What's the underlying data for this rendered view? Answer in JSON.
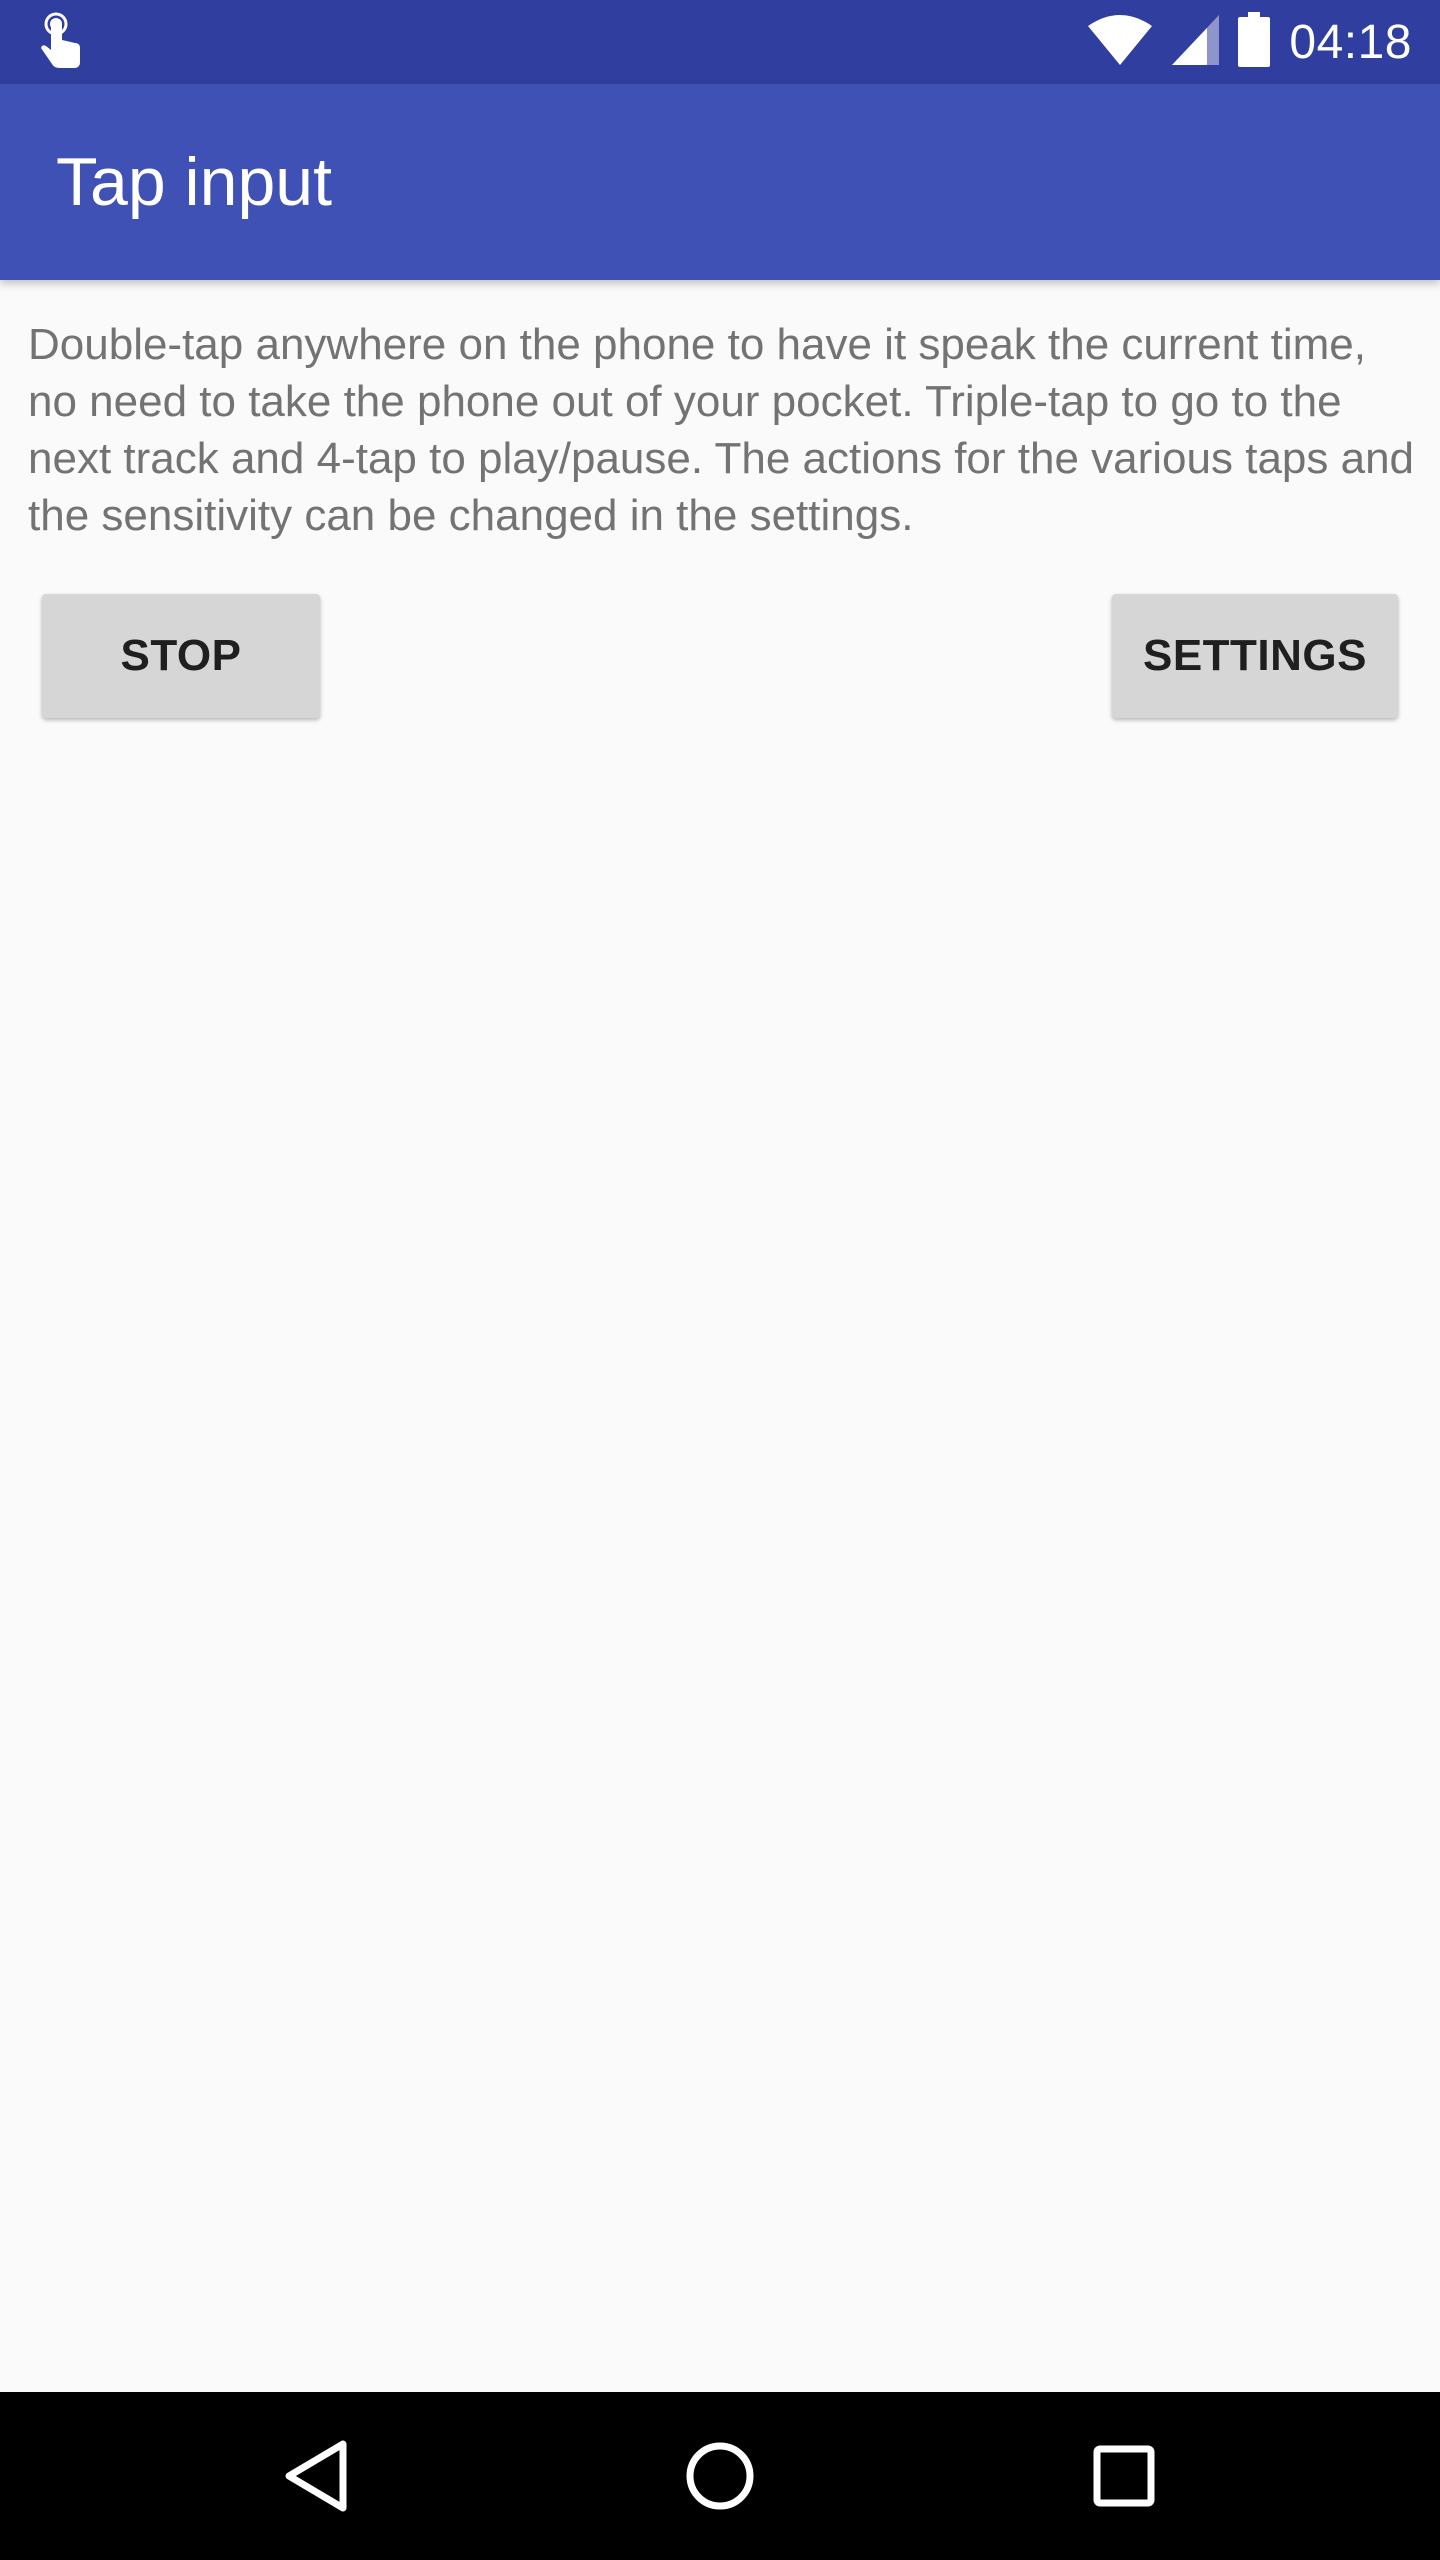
{
  "status_bar": {
    "time": "04:18",
    "notification_icon": "touch-app-icon",
    "wifi_icon": "wifi-icon",
    "signal_icon": "cell-signal-icon",
    "battery_icon": "battery-icon"
  },
  "app_bar": {
    "title": "Tap input"
  },
  "main": {
    "description": "Double-tap anywhere on the phone to have it speak the current time, no need to take the phone out of your pocket. Triple-tap to go to the next track and 4-tap to play/pause. The actions for the various taps and the sensitivity can be changed in the settings.",
    "stop_label": "STOP",
    "settings_label": "SETTINGS"
  },
  "nav_bar": {
    "back_icon": "back-triangle-icon",
    "home_icon": "home-circle-icon",
    "recents_icon": "recents-square-icon"
  },
  "colors": {
    "primary": "#3f51b5",
    "primary_dark": "#303f9f",
    "background": "#fafafa",
    "button": "#d6d6d6",
    "text_secondary": "#737373"
  }
}
